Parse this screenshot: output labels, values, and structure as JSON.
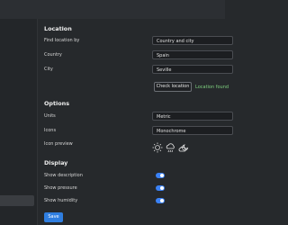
{
  "location": {
    "title": "Location",
    "find_by_label": "Find location by",
    "find_by_value": "Country and city",
    "country_label": "Country",
    "country_value": "Spain",
    "city_label": "City",
    "city_value": "Seville",
    "check_button": "Check location",
    "status_text": "Location found"
  },
  "options": {
    "title": "Options",
    "units_label": "Units",
    "units_value": "Metric",
    "icons_label": "Icons",
    "icons_value": "Monochrome",
    "preview_label": "Icon preview",
    "preview_icons": [
      "sun-icon",
      "rain-cloud-icon",
      "partly-cloudy-night-icon"
    ]
  },
  "display": {
    "title": "Display",
    "show_description_label": "Show description",
    "show_description_on": true,
    "show_pressure_label": "Show pressure",
    "show_pressure_on": true,
    "show_humidity_label": "Show humidity",
    "show_humidity_on": true
  },
  "save_label": "Save",
  "colors": {
    "background": "#26292c",
    "accent": "#3b82f6",
    "status_ok": "#7fd07f"
  }
}
